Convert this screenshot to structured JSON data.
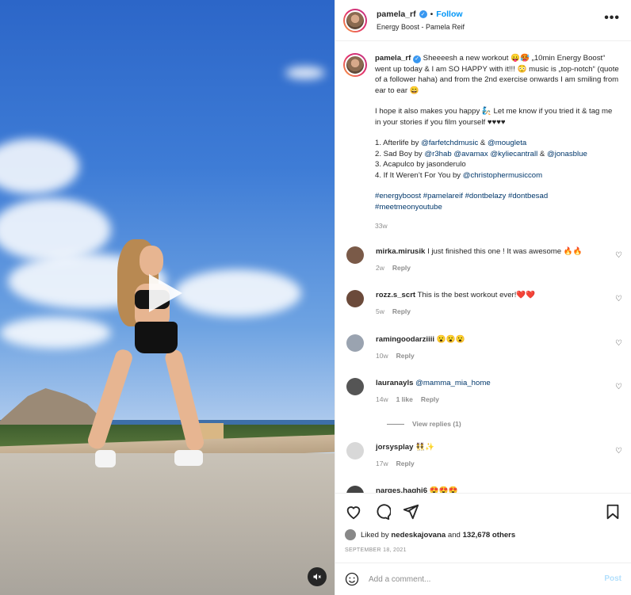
{
  "header": {
    "username": "pamela_rf",
    "follow_label": "Follow",
    "separator": "•",
    "audio": "Energy Boost - Pamela Reif",
    "more_label": "•••"
  },
  "caption": {
    "username": "pamela_rf",
    "paragraph1": "Sheeeesh a new workout 😛🥵 „10min Energy Boost“ went up today & I am SO HAPPY with it!!! 😳 music is „top-notch“ (quote of a follower haha) and from the 2nd exercise onwards I am smiling from ear to ear 😄",
    "paragraph2": "I hope it also makes you happy 🧞 Let me know if you tried it & tag me in your stories if you film yourself ♥♥♥♥",
    "songs": [
      {
        "prefix": "1. Afterlife by ",
        "mentions": [
          "@farfetchdmusic",
          "@mougleta"
        ],
        "joiners": [
          " & "
        ]
      },
      {
        "prefix": "2. Sad Boy by ",
        "mentions": [
          "@r3hab",
          "@avamax",
          "@kyliecantrall",
          "@jonasblue"
        ],
        "joiners": [
          " ",
          " ",
          " & "
        ]
      },
      {
        "prefix": "3. Acapulco by jasonderulo",
        "mentions": [],
        "joiners": []
      },
      {
        "prefix": "4. If It Weren’t For You by ",
        "mentions": [
          "@christophermusiccom"
        ],
        "joiners": []
      }
    ],
    "hashtags_line1": "#energyboost #pamelareif #dontbelazy #dontbesad",
    "hashtags_line2": "#meetmeonyoutube",
    "age": "33w"
  },
  "comments": [
    {
      "username": "mirka.mirusik",
      "text": "I just finished this one ! It was awesome 🔥🔥",
      "age": "2w",
      "likes": "",
      "reply": "Reply",
      "avatar_color": "#7a5a48"
    },
    {
      "username": "rozz.s_scrt",
      "text": "This is the best workout ever!❤️❤️",
      "age": "5w",
      "likes": "",
      "reply": "Reply",
      "avatar_color": "#6b4a3a"
    },
    {
      "username": "ramingoodarziiii",
      "text": "😮😮😮",
      "age": "10w",
      "likes": "",
      "reply": "Reply",
      "avatar_color": "#9aa3b0"
    },
    {
      "username": "lauranayls",
      "text": "@mamma_mia_home",
      "age": "14w",
      "likes": "1 like",
      "reply": "Reply",
      "avatar_color": "#555555"
    },
    {
      "username": "jorsysplay",
      "text": "👯✨",
      "age": "17w",
      "likes": "",
      "reply": "Reply",
      "avatar_color": "#d8d8d8"
    },
    {
      "username": "narges.haghi6",
      "text": "😍😍😍",
      "age": "",
      "likes": "",
      "reply": "",
      "avatar_color": "#444444"
    }
  ],
  "view_replies": "View replies (1)",
  "likes": {
    "prefix": "Liked by ",
    "user": "nedeskajovana",
    "middle": " and ",
    "count": "132,678 others"
  },
  "date": "SEPTEMBER 18, 2021",
  "add_comment": {
    "placeholder": "Add a comment...",
    "post_label": "Post"
  },
  "colors": {
    "link": "#00376b",
    "follow": "#0095f6",
    "muted": "#8e8e8e",
    "post_disabled": "#b2dffc"
  },
  "icons": [
    "play-icon",
    "mute-icon",
    "heart-icon",
    "comment-icon",
    "share-icon",
    "bookmark-icon",
    "emoji-icon",
    "verified-icon",
    "more-icon"
  ]
}
